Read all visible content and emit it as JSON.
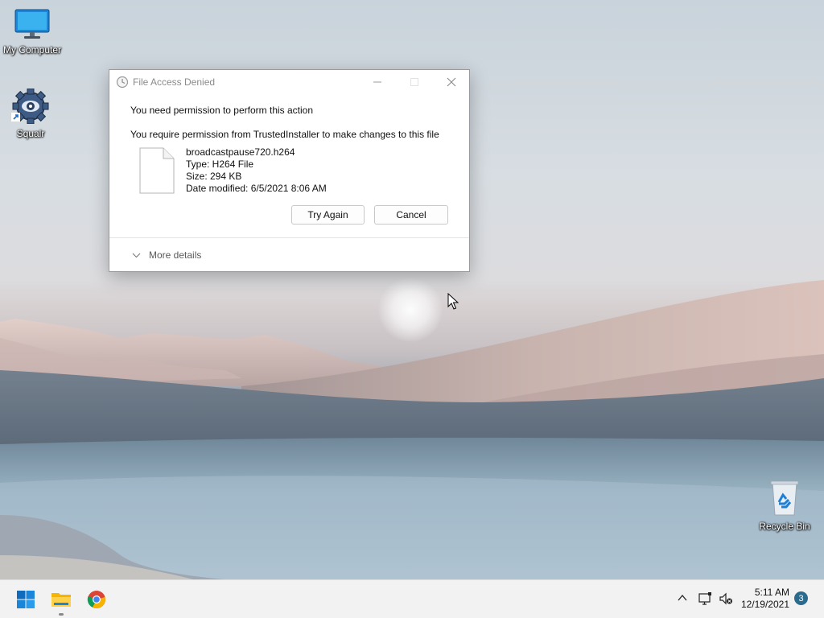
{
  "desktop": {
    "icons": [
      {
        "label": "My Computer",
        "icon": "monitor-icon"
      },
      {
        "label": "Squalr",
        "icon": "squalr-gear-icon"
      },
      {
        "label": "Recycle Bin",
        "icon": "recycle-bin-icon"
      }
    ]
  },
  "dialog": {
    "title": "File Access Denied",
    "message": "You need permission to perform this action",
    "submessage": "You require permission from TrustedInstaller to make changes to this file",
    "file": {
      "name": "broadcastpause720.h264",
      "type": "Type: H264 File",
      "size": "Size: 294 KB",
      "modified": "Date modified: 6/5/2021 8:06 AM"
    },
    "buttons": {
      "try_again": "Try Again",
      "cancel": "Cancel"
    },
    "more_details": "More details"
  },
  "taskbar": {
    "apps": [
      "start-icon",
      "file-explorer-icon",
      "chrome-icon"
    ],
    "tray": [
      "chevron-up-icon",
      "network-icon",
      "volume-muted-icon"
    ],
    "time": "5:11 AM",
    "date": "12/19/2021",
    "notification_count": "3"
  },
  "colors": {
    "accent": "#0078d4",
    "taskbar": "#f2f2f2",
    "dialog_bg": "#ffffff"
  }
}
